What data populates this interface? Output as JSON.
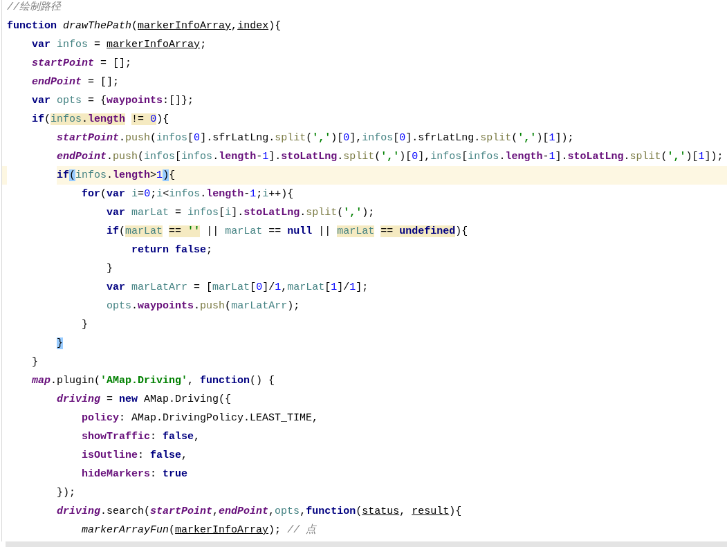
{
  "editor": {
    "lines": [
      {
        "current": false,
        "tokens": [
          {
            "kind": "cmt",
            "text": "//绘制路径"
          }
        ]
      },
      {
        "current": false,
        "tokens": [
          {
            "kind": "kw",
            "text": "function"
          },
          {
            "kind": "fn",
            "text": " drawThePath"
          },
          {
            "kind": "plain",
            "text": "("
          },
          {
            "kind": "param",
            "text": "markerInfoArray"
          },
          {
            "kind": "plain",
            "text": ","
          },
          {
            "kind": "param",
            "text": "index"
          },
          {
            "kind": "plain",
            "text": "){"
          }
        ]
      },
      {
        "current": false,
        "tokens": [
          {
            "kind": "kw",
            "text": "    var"
          },
          {
            "kind": "lvar",
            "text": " infos"
          },
          {
            "kind": "plain",
            "text": " = "
          },
          {
            "kind": "param",
            "text": "markerInfoArray"
          },
          {
            "kind": "plain",
            "text": ";"
          }
        ]
      },
      {
        "current": false,
        "tokens": [
          {
            "kind": "gvar",
            "text": "    startPoint"
          },
          {
            "kind": "plain",
            "text": " = [];"
          }
        ]
      },
      {
        "current": false,
        "tokens": [
          {
            "kind": "gvar",
            "text": "    endPoint"
          },
          {
            "kind": "plain",
            "text": " = [];"
          }
        ]
      },
      {
        "current": false,
        "tokens": [
          {
            "kind": "kw",
            "text": "    var"
          },
          {
            "kind": "lvar",
            "text": " opts"
          },
          {
            "kind": "plain",
            "text": " = {"
          },
          {
            "kind": "prop",
            "text": "waypoints"
          },
          {
            "kind": "plain",
            "text": ":[]};"
          }
        ]
      },
      {
        "current": false,
        "tokens": [
          {
            "kind": "kw",
            "text": "    if"
          },
          {
            "kind": "plain",
            "text": "("
          },
          {
            "kind": "lvar",
            "text": "infos",
            "usage": true
          },
          {
            "kind": "plain",
            "text": ".",
            "usage": true
          },
          {
            "kind": "prop",
            "text": "length",
            "usage": true
          },
          {
            "kind": "plain",
            "text": " != ",
            "usage": true
          },
          {
            "kind": "num",
            "text": "0",
            "usage": true
          },
          {
            "kind": "plain",
            "text": "){"
          }
        ]
      },
      {
        "current": false,
        "tokens": [
          {
            "kind": "gvar",
            "text": "        startPoint"
          },
          {
            "kind": "plain",
            "text": "."
          },
          {
            "kind": "method",
            "text": "push"
          },
          {
            "kind": "plain",
            "text": "("
          },
          {
            "kind": "lvar",
            "text": "infos"
          },
          {
            "kind": "plain",
            "text": "["
          },
          {
            "kind": "num",
            "text": "0"
          },
          {
            "kind": "plain",
            "text": "].sfrLatLng."
          },
          {
            "kind": "method",
            "text": "split"
          },
          {
            "kind": "plain",
            "text": "("
          },
          {
            "kind": "str",
            "text": "','"
          },
          {
            "kind": "plain",
            "text": ")["
          },
          {
            "kind": "num",
            "text": "0"
          },
          {
            "kind": "plain",
            "text": "],"
          },
          {
            "kind": "lvar",
            "text": "infos"
          },
          {
            "kind": "plain",
            "text": "["
          },
          {
            "kind": "num",
            "text": "0"
          },
          {
            "kind": "plain",
            "text": "].sfrLatLng."
          },
          {
            "kind": "method",
            "text": "split"
          },
          {
            "kind": "plain",
            "text": "("
          },
          {
            "kind": "str",
            "text": "','"
          },
          {
            "kind": "plain",
            "text": ")["
          },
          {
            "kind": "num",
            "text": "1"
          },
          {
            "kind": "plain",
            "text": "]);"
          }
        ]
      },
      {
        "current": false,
        "tokens": [
          {
            "kind": "gvar",
            "text": "        endPoint"
          },
          {
            "kind": "plain",
            "text": "."
          },
          {
            "kind": "method",
            "text": "push"
          },
          {
            "kind": "plain",
            "text": "("
          },
          {
            "kind": "lvar",
            "text": "infos"
          },
          {
            "kind": "plain",
            "text": "["
          },
          {
            "kind": "lvar",
            "text": "infos"
          },
          {
            "kind": "plain",
            "text": "."
          },
          {
            "kind": "prop",
            "text": "length"
          },
          {
            "kind": "plain",
            "text": "-"
          },
          {
            "kind": "num",
            "text": "1"
          },
          {
            "kind": "plain",
            "text": "]."
          },
          {
            "kind": "prop",
            "text": "stoLatLng"
          },
          {
            "kind": "plain",
            "text": "."
          },
          {
            "kind": "method",
            "text": "split"
          },
          {
            "kind": "plain",
            "text": "("
          },
          {
            "kind": "str",
            "text": "','"
          },
          {
            "kind": "plain",
            "text": ")["
          },
          {
            "kind": "num",
            "text": "0"
          },
          {
            "kind": "plain",
            "text": "],"
          },
          {
            "kind": "lvar",
            "text": "infos"
          },
          {
            "kind": "plain",
            "text": "["
          },
          {
            "kind": "lvar",
            "text": "infos"
          },
          {
            "kind": "plain",
            "text": "."
          },
          {
            "kind": "prop",
            "text": "length"
          },
          {
            "kind": "plain",
            "text": "-"
          },
          {
            "kind": "num",
            "text": "1"
          },
          {
            "kind": "plain",
            "text": "]."
          },
          {
            "kind": "prop",
            "text": "stoLatLng"
          },
          {
            "kind": "plain",
            "text": "."
          },
          {
            "kind": "method",
            "text": "split"
          },
          {
            "kind": "plain",
            "text": "("
          },
          {
            "kind": "str",
            "text": "','"
          },
          {
            "kind": "plain",
            "text": ")["
          },
          {
            "kind": "num",
            "text": "1"
          },
          {
            "kind": "plain",
            "text": "]);"
          }
        ]
      },
      {
        "current": true,
        "tokens": [
          {
            "kind": "kw",
            "text": "        if"
          },
          {
            "kind": "plain",
            "text": "(",
            "brace": true
          },
          {
            "kind": "lvar",
            "text": "infos"
          },
          {
            "kind": "plain",
            "text": "."
          },
          {
            "kind": "prop",
            "text": "length"
          },
          {
            "kind": "plain",
            "text": ">"
          },
          {
            "kind": "num",
            "text": "1"
          },
          {
            "kind": "plain",
            "text": ")",
            "brace": true
          },
          {
            "kind": "plain",
            "text": "{"
          }
        ]
      },
      {
        "current": false,
        "tokens": [
          {
            "kind": "kw",
            "text": "            for"
          },
          {
            "kind": "plain",
            "text": "("
          },
          {
            "kind": "kw",
            "text": "var"
          },
          {
            "kind": "lvar",
            "text": " i"
          },
          {
            "kind": "plain",
            "text": "="
          },
          {
            "kind": "num",
            "text": "0"
          },
          {
            "kind": "plain",
            "text": ";"
          },
          {
            "kind": "lvar",
            "text": "i"
          },
          {
            "kind": "plain",
            "text": "<"
          },
          {
            "kind": "lvar",
            "text": "infos"
          },
          {
            "kind": "plain",
            "text": "."
          },
          {
            "kind": "prop",
            "text": "length"
          },
          {
            "kind": "plain",
            "text": "-"
          },
          {
            "kind": "num",
            "text": "1"
          },
          {
            "kind": "plain",
            "text": ";"
          },
          {
            "kind": "lvar",
            "text": "i"
          },
          {
            "kind": "plain",
            "text": "++){"
          }
        ]
      },
      {
        "current": false,
        "tokens": [
          {
            "kind": "kw",
            "text": "                var"
          },
          {
            "kind": "lvar",
            "text": " marLat"
          },
          {
            "kind": "plain",
            "text": " = "
          },
          {
            "kind": "lvar",
            "text": "infos"
          },
          {
            "kind": "plain",
            "text": "["
          },
          {
            "kind": "lvar",
            "text": "i"
          },
          {
            "kind": "plain",
            "text": "]."
          },
          {
            "kind": "prop",
            "text": "stoLatLng"
          },
          {
            "kind": "plain",
            "text": "."
          },
          {
            "kind": "method",
            "text": "split"
          },
          {
            "kind": "plain",
            "text": "("
          },
          {
            "kind": "str",
            "text": "','"
          },
          {
            "kind": "plain",
            "text": ");"
          }
        ]
      },
      {
        "current": false,
        "tokens": [
          {
            "kind": "kw",
            "text": "                if"
          },
          {
            "kind": "plain",
            "text": "("
          },
          {
            "kind": "lvar",
            "text": "marLat",
            "usage": true
          },
          {
            "kind": "plain",
            "text": " == ",
            "usage": true
          },
          {
            "kind": "str",
            "text": "''",
            "usage": true
          },
          {
            "kind": "plain",
            "text": " || "
          },
          {
            "kind": "lvar",
            "text": "marLat"
          },
          {
            "kind": "plain",
            "text": " == "
          },
          {
            "kind": "kw",
            "text": "null"
          },
          {
            "kind": "plain",
            "text": " || "
          },
          {
            "kind": "lvar",
            "text": "marLat",
            "usage": true
          },
          {
            "kind": "plain",
            "text": " == ",
            "usage": true
          },
          {
            "kind": "kw",
            "text": "undefined",
            "usage": true
          },
          {
            "kind": "plain",
            "text": "){"
          }
        ]
      },
      {
        "current": false,
        "tokens": [
          {
            "kind": "kw",
            "text": "                    return false"
          },
          {
            "kind": "plain",
            "text": ";"
          }
        ]
      },
      {
        "current": false,
        "tokens": [
          {
            "kind": "plain",
            "text": "                }"
          }
        ]
      },
      {
        "current": false,
        "tokens": [
          {
            "kind": "kw",
            "text": "                var"
          },
          {
            "kind": "lvar",
            "text": " marLatArr"
          },
          {
            "kind": "plain",
            "text": " = ["
          },
          {
            "kind": "lvar",
            "text": "marLat"
          },
          {
            "kind": "plain",
            "text": "["
          },
          {
            "kind": "num",
            "text": "0"
          },
          {
            "kind": "plain",
            "text": "]/"
          },
          {
            "kind": "num",
            "text": "1"
          },
          {
            "kind": "plain",
            "text": ","
          },
          {
            "kind": "lvar",
            "text": "marLat"
          },
          {
            "kind": "plain",
            "text": "["
          },
          {
            "kind": "num",
            "text": "1"
          },
          {
            "kind": "plain",
            "text": "]/"
          },
          {
            "kind": "num",
            "text": "1"
          },
          {
            "kind": "plain",
            "text": "];"
          }
        ]
      },
      {
        "current": false,
        "tokens": [
          {
            "kind": "lvar",
            "text": "                opts"
          },
          {
            "kind": "plain",
            "text": "."
          },
          {
            "kind": "prop",
            "text": "waypoints"
          },
          {
            "kind": "plain",
            "text": "."
          },
          {
            "kind": "method",
            "text": "push"
          },
          {
            "kind": "plain",
            "text": "("
          },
          {
            "kind": "lvar",
            "text": "marLatArr"
          },
          {
            "kind": "plain",
            "text": ");"
          }
        ]
      },
      {
        "current": false,
        "tokens": [
          {
            "kind": "plain",
            "text": "            }"
          }
        ]
      },
      {
        "current": false,
        "tokens": [
          {
            "kind": "plain",
            "text": "        }",
            "brace": true
          }
        ]
      },
      {
        "current": false,
        "tokens": [
          {
            "kind": "plain",
            "text": "    }"
          }
        ]
      },
      {
        "current": false,
        "tokens": [
          {
            "kind": "gvar",
            "text": "    map"
          },
          {
            "kind": "plain",
            "text": ".plugin("
          },
          {
            "kind": "str",
            "text": "'AMap.Driving'"
          },
          {
            "kind": "plain",
            "text": ", "
          },
          {
            "kind": "kw",
            "text": "function"
          },
          {
            "kind": "plain",
            "text": "() {"
          }
        ]
      },
      {
        "current": false,
        "tokens": [
          {
            "kind": "gvar",
            "text": "        driving"
          },
          {
            "kind": "plain",
            "text": " = "
          },
          {
            "kind": "kw",
            "text": "new"
          },
          {
            "kind": "plain",
            "text": " AMap.Driving({"
          }
        ]
      },
      {
        "current": false,
        "tokens": [
          {
            "kind": "prop",
            "text": "            policy"
          },
          {
            "kind": "plain",
            "text": ": AMap.DrivingPolicy.LEAST_TIME,"
          }
        ]
      },
      {
        "current": false,
        "tokens": [
          {
            "kind": "prop",
            "text": "            showTraffic"
          },
          {
            "kind": "plain",
            "text": ": "
          },
          {
            "kind": "kw",
            "text": "false"
          },
          {
            "kind": "plain",
            "text": ","
          }
        ]
      },
      {
        "current": false,
        "tokens": [
          {
            "kind": "prop",
            "text": "            isOutline"
          },
          {
            "kind": "plain",
            "text": ": "
          },
          {
            "kind": "kw",
            "text": "false"
          },
          {
            "kind": "plain",
            "text": ","
          }
        ]
      },
      {
        "current": false,
        "tokens": [
          {
            "kind": "prop",
            "text": "            hideMarkers"
          },
          {
            "kind": "plain",
            "text": ": "
          },
          {
            "kind": "kw",
            "text": "true"
          }
        ]
      },
      {
        "current": false,
        "tokens": [
          {
            "kind": "plain",
            "text": "        });"
          }
        ]
      },
      {
        "current": false,
        "tokens": [
          {
            "kind": "gvar",
            "text": "        driving"
          },
          {
            "kind": "plain",
            "text": ".search("
          },
          {
            "kind": "gvar",
            "text": "startPoint"
          },
          {
            "kind": "plain",
            "text": ","
          },
          {
            "kind": "gvar",
            "text": "endPoint"
          },
          {
            "kind": "plain",
            "text": ","
          },
          {
            "kind": "lvar",
            "text": "opts"
          },
          {
            "kind": "plain",
            "text": ","
          },
          {
            "kind": "kw",
            "text": "function"
          },
          {
            "kind": "plain",
            "text": "("
          },
          {
            "kind": "param",
            "text": "status"
          },
          {
            "kind": "plain",
            "text": ", "
          },
          {
            "kind": "param",
            "text": "result"
          },
          {
            "kind": "plain",
            "text": "){"
          }
        ]
      },
      {
        "current": false,
        "tokens": [
          {
            "kind": "fn",
            "text": "            markerArrayFun"
          },
          {
            "kind": "plain",
            "text": "("
          },
          {
            "kind": "param",
            "text": "markerInfoArray"
          },
          {
            "kind": "plain",
            "text": "); "
          },
          {
            "kind": "cmt",
            "text": "// 点"
          }
        ]
      }
    ]
  }
}
